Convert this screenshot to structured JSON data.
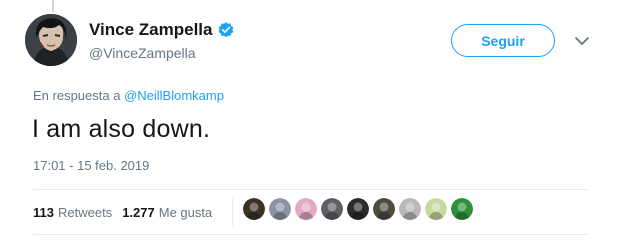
{
  "author": {
    "display_name": "Vince Zampella",
    "handle": "@VinceZampella",
    "verified": true,
    "avatar_icon": "author-avatar-illustration"
  },
  "follow_button": {
    "label": "Seguir",
    "color": "#1da1f2"
  },
  "menu": {
    "icon": "chevron-down-icon"
  },
  "reply_context": {
    "prefix": "En respuesta a",
    "mention": "@NeillBlomkamp"
  },
  "tweet": {
    "text": "I am also down.",
    "timestamp": "17:01 - 15 feb. 2019"
  },
  "stats": {
    "retweets_count": "113",
    "retweets_label": "Retweets",
    "likes_count": "1.277",
    "likes_label": "Me gusta"
  },
  "likers": [
    {
      "icon": "liker-avatar-1",
      "color": "#3a3226"
    },
    {
      "icon": "liker-avatar-2",
      "color": "#8a93a6"
    },
    {
      "icon": "liker-avatar-3",
      "color": "#e6a9c4"
    },
    {
      "icon": "liker-avatar-4",
      "color": "#5d5f63"
    },
    {
      "icon": "liker-avatar-5",
      "color": "#2b2b2b"
    },
    {
      "icon": "liker-avatar-6",
      "color": "#4e4a3c"
    },
    {
      "icon": "liker-avatar-7",
      "color": "#b9b9b9"
    },
    {
      "icon": "liker-avatar-8",
      "color": "#c8d9a0"
    },
    {
      "icon": "liker-avatar-9",
      "color": "#2f8f3a"
    }
  ],
  "colors": {
    "accent": "#1da1f2",
    "text": "#14171a",
    "muted": "#657786",
    "divider": "#e6ecf0"
  }
}
